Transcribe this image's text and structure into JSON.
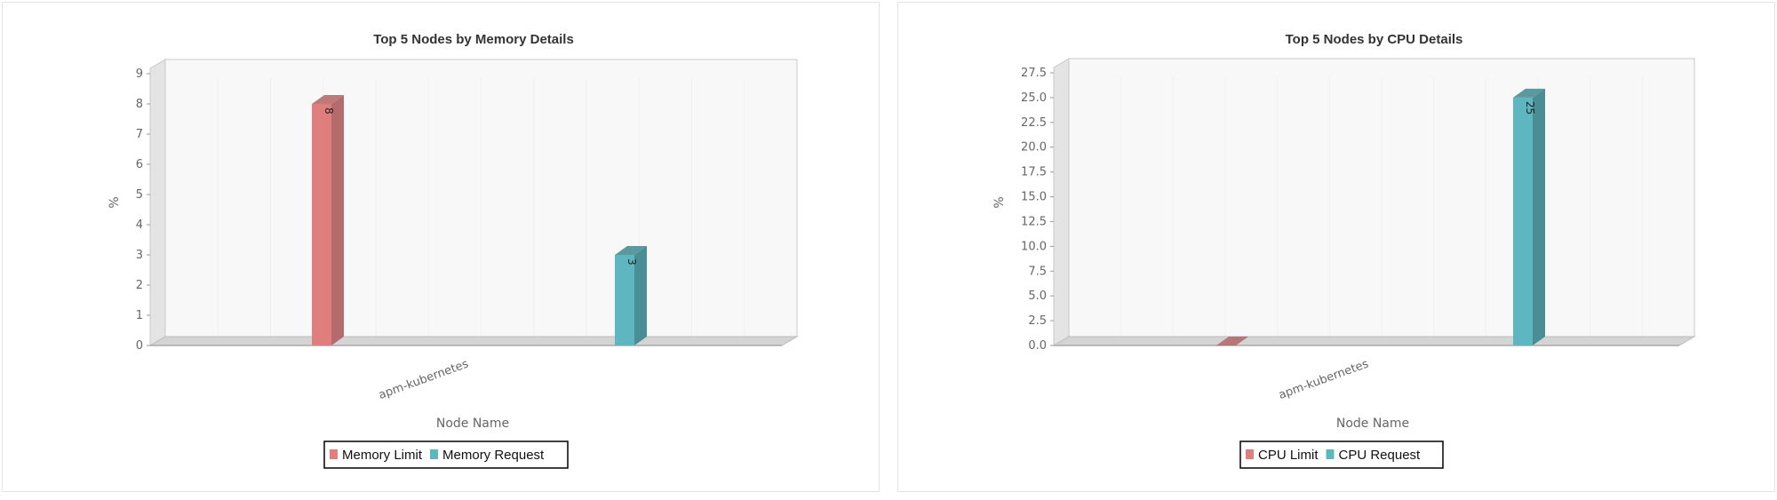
{
  "chart_data": [
    {
      "type": "bar",
      "title": "Top 5 Nodes by Memory Details",
      "xlabel": "Node Name",
      "ylabel": "%",
      "categories": [
        "apm-kubernetes"
      ],
      "ylim": [
        0,
        9
      ],
      "yticks": [
        "0",
        "1",
        "2",
        "3",
        "4",
        "5",
        "6",
        "7",
        "8",
        "9"
      ],
      "series": [
        {
          "name": "Memory Limit",
          "values": [
            8
          ],
          "color": "#e07e7e",
          "side": "#b56b6b"
        },
        {
          "name": "Memory Request",
          "values": [
            3
          ],
          "color": "#5db6c0",
          "side": "#4a8e95"
        }
      ],
      "style": "3d-column",
      "legend": "bottom",
      "data_labels": true
    },
    {
      "type": "bar",
      "title": "Top 5 Nodes by CPU Details",
      "xlabel": "Node Name",
      "ylabel": "%",
      "categories": [
        "apm-kubernetes"
      ],
      "ylim": [
        0,
        27.5
      ],
      "yticks": [
        "0.0",
        "2.5",
        "5.0",
        "7.5",
        "10.0",
        "12.5",
        "15.0",
        "17.5",
        "20.0",
        "22.5",
        "25.0",
        "27.5"
      ],
      "series": [
        {
          "name": "CPU Limit",
          "values": [
            0
          ],
          "color": "#e07e7e",
          "side": "#b56b6b"
        },
        {
          "name": "CPU Request",
          "values": [
            25
          ],
          "color": "#5db6c0",
          "side": "#4a8e95"
        }
      ],
      "style": "3d-column",
      "legend": "bottom",
      "data_labels": true
    }
  ]
}
